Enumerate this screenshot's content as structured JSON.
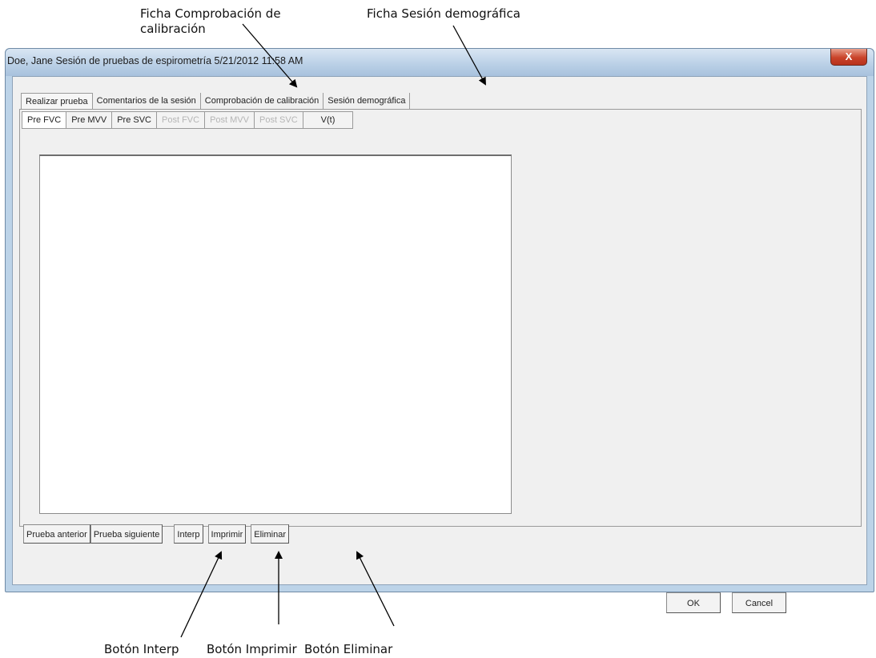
{
  "window": {
    "title": "Doe, Jane Sesión de pruebas de espirometría 5/21/2012 11:58 AM",
    "close_label": "X"
  },
  "tabs": [
    {
      "label": "Realizar prueba",
      "active": true
    },
    {
      "label": "Comentarios de la sesión"
    },
    {
      "label": "Comprobación de calibración"
    },
    {
      "label": "Sesión demográfica"
    }
  ],
  "subtabs": [
    {
      "label": "Pre FVC",
      "active": true
    },
    {
      "label": "Pre MVV"
    },
    {
      "label": "Pre SVC"
    },
    {
      "label": "Post FVC",
      "disabled": true
    },
    {
      "label": "Post MVV",
      "disabled": true
    },
    {
      "label": "Post SVC",
      "disabled": true
    },
    {
      "label": "V(t)"
    }
  ],
  "buttons": {
    "prev": "Prueba anterior",
    "next": "Prueba siguiente",
    "interp": "Interp",
    "print": "Imprimir",
    "delete": "Eliminar",
    "ok": "OK",
    "cancel": "Cancel"
  },
  "callouts": {
    "calibration_line1": "Ficha Comprobación de",
    "calibration_line2": "calibración",
    "demographic": "Ficha Sesión demográfica",
    "interp": "Botón Interp",
    "print": "Botón Imprimir",
    "delete": "Botón Eliminar"
  }
}
